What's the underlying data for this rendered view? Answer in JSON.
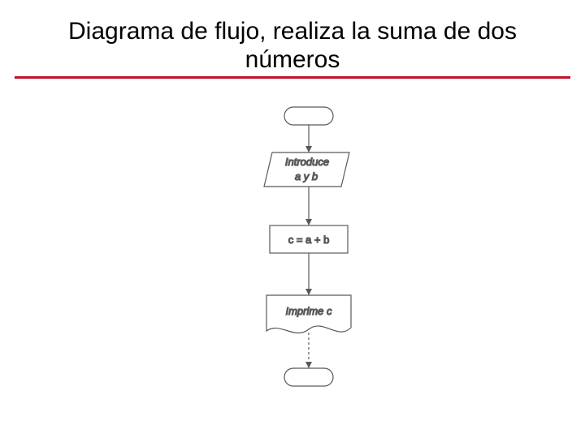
{
  "title": {
    "line1": "Diagrama de flujo, realiza la suma de dos",
    "line2": "números"
  },
  "flowchart": {
    "nodes": {
      "start": {
        "type": "terminator",
        "label": ""
      },
      "input": {
        "type": "io",
        "line1": "Introduce",
        "line2": "a y b"
      },
      "process": {
        "type": "process",
        "label": "c = a + b"
      },
      "output": {
        "type": "document",
        "label": "Imprime c"
      },
      "end": {
        "type": "terminator",
        "label": ""
      }
    },
    "edges": [
      [
        "start",
        "input"
      ],
      [
        "input",
        "process"
      ],
      [
        "process",
        "output"
      ],
      [
        "output",
        "end"
      ]
    ]
  },
  "colors": {
    "accent": "#c0102a",
    "stroke": "#595959"
  }
}
